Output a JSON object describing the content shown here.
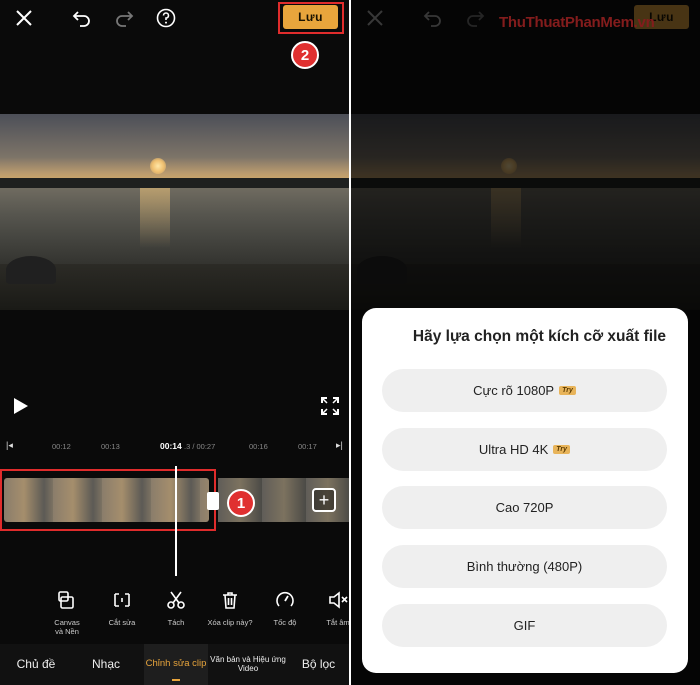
{
  "left": {
    "toolbar": {
      "save_label": "Lưu"
    },
    "badges": {
      "save": "2",
      "clip": "1"
    },
    "ruler": {
      "t1": "00:12",
      "t2": "00:13",
      "current": "00:14",
      "sub": ".3 / 00:27",
      "t4": "00:16",
      "t5": "00:17"
    },
    "tools": [
      {
        "label": "Canvas\nvà Nền",
        "icon": "canvas-icon"
      },
      {
        "label": "Cắt sửa",
        "icon": "trim-icon"
      },
      {
        "label": "Tách",
        "icon": "scissors-icon"
      },
      {
        "label": "Xóa clip này?",
        "icon": "trash-icon"
      },
      {
        "label": "Tốc độ",
        "icon": "speed-icon"
      },
      {
        "label": "Tắt âm",
        "icon": "mute-icon"
      }
    ],
    "nav": [
      {
        "label": "Chủ đề"
      },
      {
        "label": "Nhạc"
      },
      {
        "label": "Chỉnh sửa clip"
      },
      {
        "label": "Văn bản và Hiệu ứng Video"
      },
      {
        "label": "Bộ lọc"
      }
    ]
  },
  "right": {
    "toolbar": {
      "save_label": "Lưu"
    },
    "watermark": "ThuThuatPhanMem.vn",
    "sheet": {
      "title": "Hãy lựa chọn một kích cỡ xuất file",
      "options": [
        {
          "label": "Cực rõ 1080P",
          "tag": "Try"
        },
        {
          "label": "Ultra HD 4K",
          "tag": "Try"
        },
        {
          "label": "Cao 720P",
          "tag": ""
        },
        {
          "label": "Bình thường (480P)",
          "tag": ""
        },
        {
          "label": "GIF",
          "tag": ""
        }
      ]
    }
  },
  "colors": {
    "accent": "#e8a53c",
    "highlight": "#e02c2c"
  }
}
